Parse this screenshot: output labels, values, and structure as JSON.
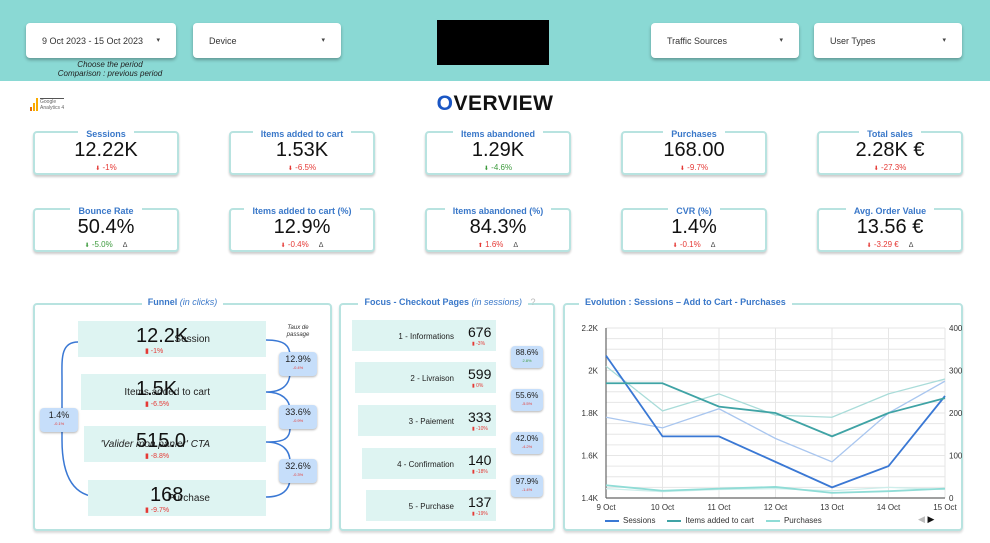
{
  "header": {
    "date_range": "9 Oct 2023 - 15 Oct 2023",
    "device_label": "Device",
    "traffic_sources_label": "Traffic Sources",
    "user_types_label": "User Types",
    "hint_line1": "Choose the period",
    "hint_line2": "Comparison : previous period",
    "caret": "▾"
  },
  "logo": {
    "line1": "Google",
    "line2": "Analytics 4"
  },
  "title": {
    "first_letter": "O",
    "rest": "VERVIEW"
  },
  "kpis": [
    {
      "label": "Sessions",
      "value": "12.22K",
      "delta": "-1%",
      "trend": "down",
      "status": "bad"
    },
    {
      "label": "Items added to cart",
      "value": "1.53K",
      "delta": "-6.5%",
      "trend": "down",
      "status": "bad"
    },
    {
      "label": "Items abandoned",
      "value": "1.29K",
      "delta": "-4.6%",
      "trend": "down",
      "status": "good"
    },
    {
      "label": "Purchases",
      "value": "168.00",
      "delta": "-9.7%",
      "trend": "down",
      "status": "bad",
      "help": "?"
    },
    {
      "label": "Total sales",
      "value": "2.28K €",
      "delta": "-27.3%",
      "trend": "down",
      "status": "bad"
    },
    {
      "label": "Bounce Rate",
      "value": "50.4%",
      "delta": "-5.0%",
      "trend": "down",
      "status": "good",
      "delta_icon": "Δ"
    },
    {
      "label": "Items added to cart (%)",
      "value": "12.9%",
      "delta": "-0.4%",
      "trend": "down",
      "status": "bad",
      "delta_icon": "Δ"
    },
    {
      "label": "Items abandoned (%)",
      "value": "84.3%",
      "delta": "1.6%",
      "trend": "up",
      "status": "bad",
      "delta_icon": "Δ"
    },
    {
      "label": "CVR (%)",
      "value": "1.4%",
      "delta": "-0.1%",
      "trend": "down",
      "status": "bad",
      "delta_icon": "Δ"
    },
    {
      "label": "Avg. Order Value",
      "value": "13.56 €",
      "delta": "-3.29 €",
      "trend": "down",
      "status": "bad",
      "delta_icon": "Δ"
    }
  ],
  "funnel": {
    "title": "Funnel",
    "title_suffix": "(in clicks)",
    "rate_header_line1": "Taux de",
    "rate_header_line2": "passage",
    "steps": [
      {
        "name": "Session",
        "value": "12.2K",
        "delta": "-1%"
      },
      {
        "name": "Items added to cart",
        "value": "1.5K",
        "delta": "-6.5%"
      },
      {
        "name": "'Valider mon panier' CTA",
        "value": "515.0",
        "delta": "-8.8%"
      },
      {
        "name": "Purchase",
        "value": "168",
        "delta": "-9.7%"
      }
    ],
    "rates": [
      {
        "value": "12.9%",
        "delta": "-0.4%"
      },
      {
        "value": "33.6%",
        "delta": "-0.9%"
      },
      {
        "value": "32.6%",
        "delta": "-0.3%"
      }
    ],
    "overall": {
      "value": "1.4%",
      "delta": "-0.1%"
    }
  },
  "checkout": {
    "title": "Focus - Checkout Pages",
    "title_suffix": "(in sessions)",
    "help": "?",
    "steps": [
      {
        "name": "1 - Informations",
        "value": "676",
        "delta": "-3%"
      },
      {
        "name": "2 - Livraison",
        "value": "599",
        "delta": "0%"
      },
      {
        "name": "3 - Paiement",
        "value": "333",
        "delta": "-10%"
      },
      {
        "name": "4 - Confirmation",
        "value": "140",
        "delta": "-18%"
      },
      {
        "name": "5 - Purchase",
        "value": "137",
        "delta": "-19%"
      }
    ],
    "rates": [
      {
        "value": "88.6%",
        "delta": "2.8%",
        "status": "good"
      },
      {
        "value": "55.6%",
        "delta": "-5.5%",
        "status": "bad"
      },
      {
        "value": "42.0%",
        "delta": "-4.2%",
        "status": "bad"
      },
      {
        "value": "97.9%",
        "delta": "-1.4%",
        "status": "bad"
      }
    ]
  },
  "chart_data": {
    "type": "line",
    "title": "Evolution : Sessions – Add to Cart - Purchases",
    "x": [
      "9 Oct",
      "10 Oct",
      "11 Oct",
      "12 Oct",
      "13 Oct",
      "14 Oct",
      "15 Oct"
    ],
    "y_left": {
      "ylim": [
        1400,
        2200
      ],
      "ticks": [
        "1.4K",
        "1.6K",
        "1.8K",
        "2K",
        "2.2K"
      ],
      "tick_values": [
        1400,
        1600,
        1800,
        2000,
        2200
      ]
    },
    "y_right": {
      "ylim": [
        0,
        400
      ],
      "ticks": [
        "0",
        "100",
        "200",
        "300",
        "400"
      ],
      "tick_values": [
        0,
        100,
        200,
        300,
        400
      ]
    },
    "grid": true,
    "legend_position": "bottom",
    "series": [
      {
        "name": "Sessions",
        "axis": "left",
        "color": "#3a78d4",
        "values": [
          2070,
          1690,
          1690,
          1570,
          1450,
          1550,
          1880
        ]
      },
      {
        "name": "Items added to cart",
        "axis": "left",
        "color": "#3fa3a5",
        "values": [
          1940,
          1940,
          1830,
          1800,
          1690,
          1800,
          1870
        ]
      },
      {
        "name": "Purchases",
        "axis": "right",
        "color": "#8fdcd6",
        "values": [
          30,
          17,
          22,
          26,
          12,
          16,
          22
        ]
      }
    ],
    "comparison_series": [
      {
        "name": "Sessions (previous period)",
        "axis": "left",
        "color": "#a9c6ef",
        "values": [
          1780,
          1730,
          1820,
          1680,
          1570,
          1800,
          1950
        ]
      },
      {
        "name": "Items added to cart (previous period)",
        "axis": "left",
        "color": "#a9dcd9",
        "values": [
          2020,
          1810,
          1890,
          1790,
          1780,
          1890,
          1960
        ]
      },
      {
        "name": "Purchases (previous period)",
        "axis": "right",
        "color": "#cdeeeb",
        "values": [
          22,
          15,
          20,
          22,
          17,
          25,
          20
        ]
      }
    ],
    "pager": {
      "prev": "◀",
      "next": "▶"
    }
  }
}
